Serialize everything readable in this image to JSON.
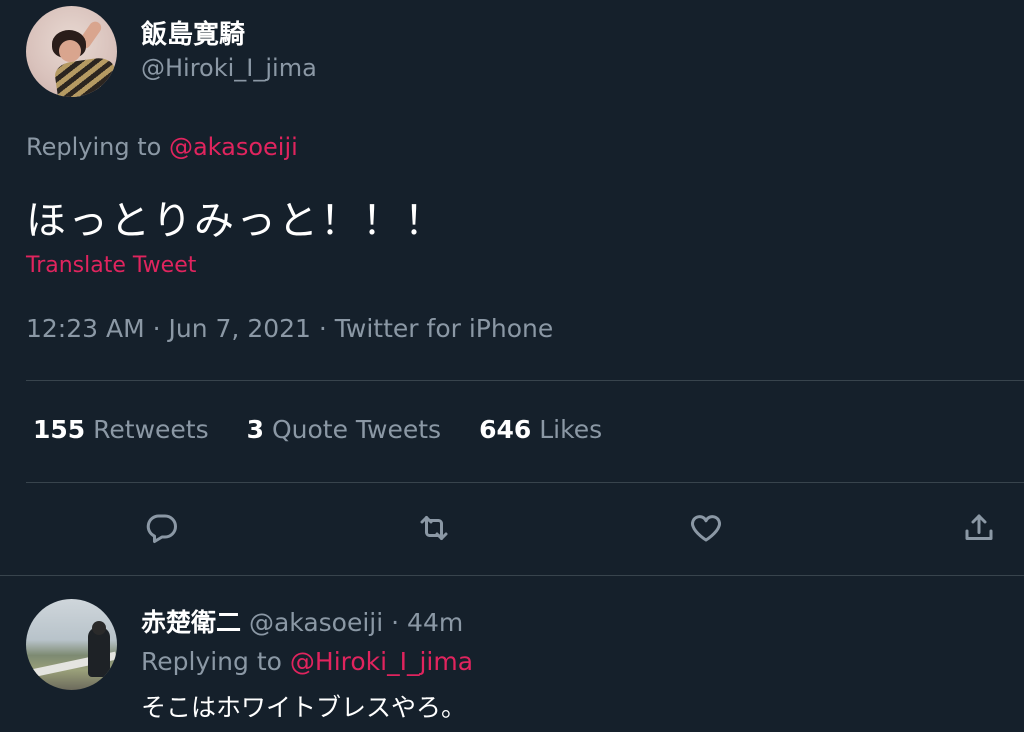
{
  "tweet": {
    "display_name": "飯島寛騎",
    "handle": "@Hiroki_I_jima",
    "replying_prefix": "Replying to ",
    "replying_mention": "@akasoeiji",
    "text": "ほっとりみっと！！！",
    "translate_label": "Translate Tweet",
    "meta": "12:23 AM · Jun 7, 2021 · Twitter for iPhone",
    "stats": [
      {
        "count": "155",
        "label": "Retweets"
      },
      {
        "count": "3",
        "label": "Quote Tweets"
      },
      {
        "count": "646",
        "label": "Likes"
      }
    ],
    "actions": [
      "reply-icon",
      "retweet-icon",
      "like-icon",
      "share-icon"
    ]
  },
  "reply": {
    "display_name": "赤楚衛二",
    "handle": "@akasoeiji",
    "time": "44m",
    "replying_prefix": "Replying to ",
    "replying_mention": "@Hiroki_I_jima",
    "text": "そこはホワイトブレスやろ。"
  },
  "colors": {
    "background": "#15202b",
    "accent": "#e0245e",
    "secondary_text": "#8b98a5",
    "divider": "#38444d"
  }
}
